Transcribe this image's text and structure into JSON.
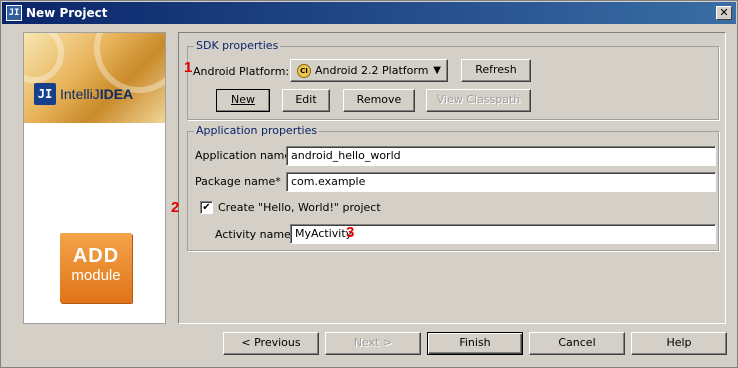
{
  "window": {
    "title": "New Project",
    "icon_text": "JI",
    "close_glyph": "✕"
  },
  "side": {
    "logo_mark": "JI",
    "logo_text_plain": "IntelliJ",
    "logo_text_bold": "IDEA",
    "add_text": "ADD",
    "module_text": "module"
  },
  "sdk": {
    "legend": "SDK properties",
    "platform_label": "Android Platform:",
    "platform_value": "Android 2.2 Platform",
    "platform_icon_text": "CI",
    "refresh": "Refresh",
    "new": "New",
    "edit": "Edit",
    "remove": "Remove",
    "view_classpath": "View Classpath"
  },
  "app": {
    "legend": "Application properties",
    "app_name_label": "Application name",
    "app_name_value": "android_hello_world",
    "package_label": "Package name*",
    "package_value": "com.example",
    "create_label": "Create \"Hello, World!\" project",
    "create_checked": "✔",
    "activity_label": "Activity name",
    "activity_value": "MyActivity"
  },
  "markers": {
    "one": "1",
    "two": "2",
    "three": "3"
  },
  "buttons": {
    "previous": "< Previous",
    "next": "Next >",
    "finish": "Finish",
    "cancel": "Cancel",
    "help": "Help"
  },
  "colors": {
    "title_start": "#0a246a",
    "title_end": "#3a6ea5",
    "legend": "#0a246a",
    "marker": "#e00000",
    "add_module": "#f08a28"
  }
}
